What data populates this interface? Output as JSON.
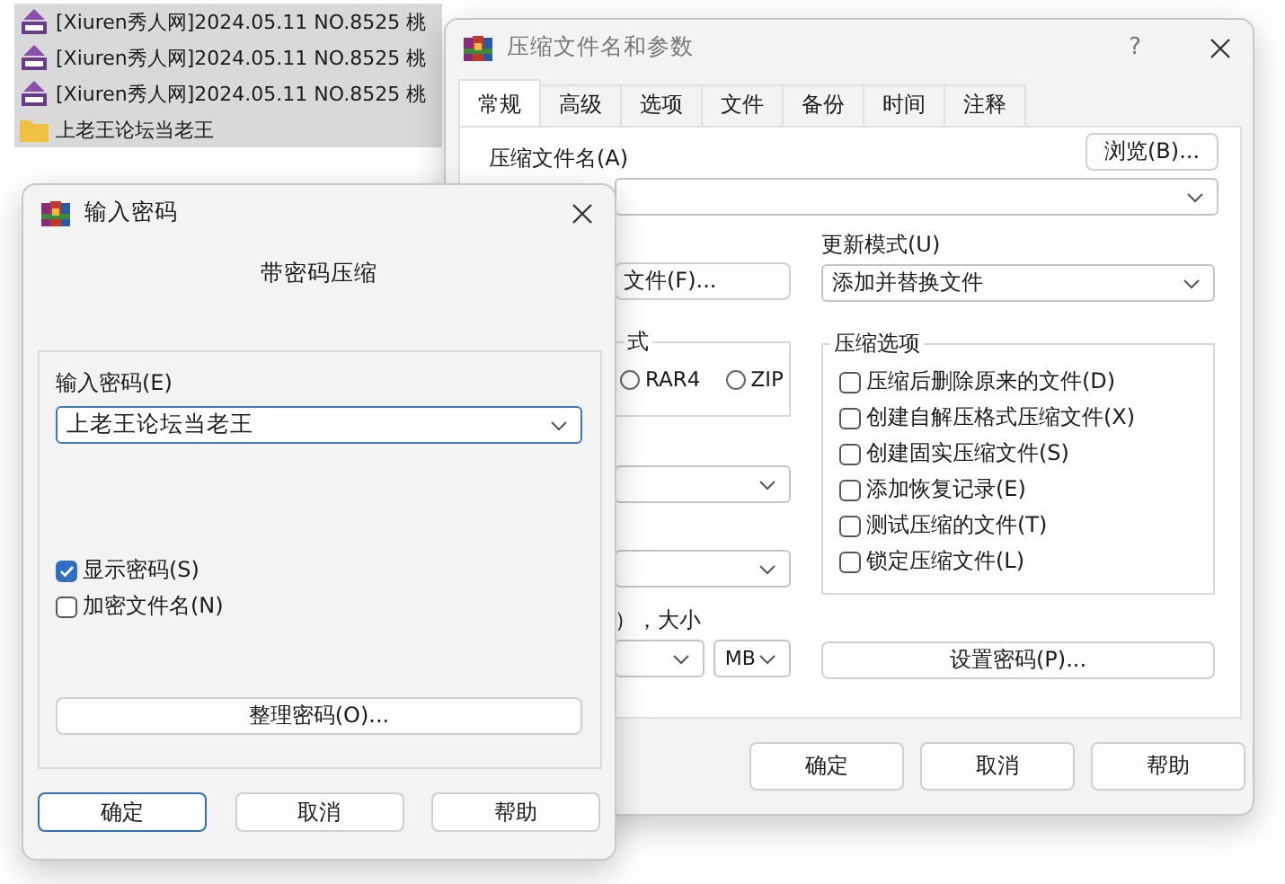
{
  "file_list": {
    "rows": [
      {
        "kind": "archive",
        "name": "[Xiuren秀人网]2024.05.11 NO.8525 桃",
        "selected": true
      },
      {
        "kind": "archive",
        "name": "[Xiuren秀人网]2024.05.11 NO.8525 桃",
        "selected": true
      },
      {
        "kind": "archive",
        "name": "[Xiuren秀人网]2024.05.11 NO.8525 桃",
        "selected": true
      },
      {
        "kind": "folder",
        "name": "上老王论坛当老王",
        "selected": true
      }
    ]
  },
  "archive_dialog": {
    "title": "压缩文件名和参数",
    "help_button": "?",
    "tabs": [
      {
        "label": "常规",
        "selected": true
      },
      {
        "label": "高级",
        "selected": false
      },
      {
        "label": "选项",
        "selected": false
      },
      {
        "label": "文件",
        "selected": false
      },
      {
        "label": "备份",
        "selected": false
      },
      {
        "label": "时间",
        "selected": false
      },
      {
        "label": "注释",
        "selected": false
      }
    ],
    "archive_name_label": "压缩文件名(A)",
    "browse_button": "浏览(B)...",
    "profile_button": "文件(F)...",
    "format_group_label": "式",
    "formats": [
      {
        "label": "RAR4",
        "selected": false
      },
      {
        "label": "ZIP",
        "selected": false
      }
    ],
    "split_label": "），大小",
    "split_unit": "MB",
    "update_mode_label": "更新模式(U)",
    "update_mode_value": "添加并替换文件",
    "options_label": "压缩选项",
    "options": [
      {
        "label": "压缩后删除原来的文件(D)",
        "checked": false
      },
      {
        "label": "创建自解压格式压缩文件(X)",
        "checked": false
      },
      {
        "label": "创建固实压缩文件(S)",
        "checked": false
      },
      {
        "label": "添加恢复记录(E)",
        "checked": false
      },
      {
        "label": "测试压缩的文件(T)",
        "checked": false
      },
      {
        "label": "锁定压缩文件(L)",
        "checked": false
      }
    ],
    "set_password_button": "设置密码(P)...",
    "buttons": [
      {
        "label": "确定",
        "default": false
      },
      {
        "label": "取消",
        "default": false
      },
      {
        "label": "帮助",
        "default": false
      }
    ]
  },
  "password_dialog": {
    "title": "输入密码",
    "heading": "带密码压缩",
    "password_label": "输入密码(E)",
    "password_value": "上老王论坛当老王",
    "options": [
      {
        "label": "显示密码(S)",
        "checked": true
      },
      {
        "label": "加密文件名(N)",
        "checked": false
      }
    ],
    "organize_button": "整理密码(O)...",
    "buttons": [
      {
        "label": "确定",
        "default": true
      },
      {
        "label": "取消",
        "default": false
      },
      {
        "label": "帮助",
        "default": false
      }
    ]
  }
}
